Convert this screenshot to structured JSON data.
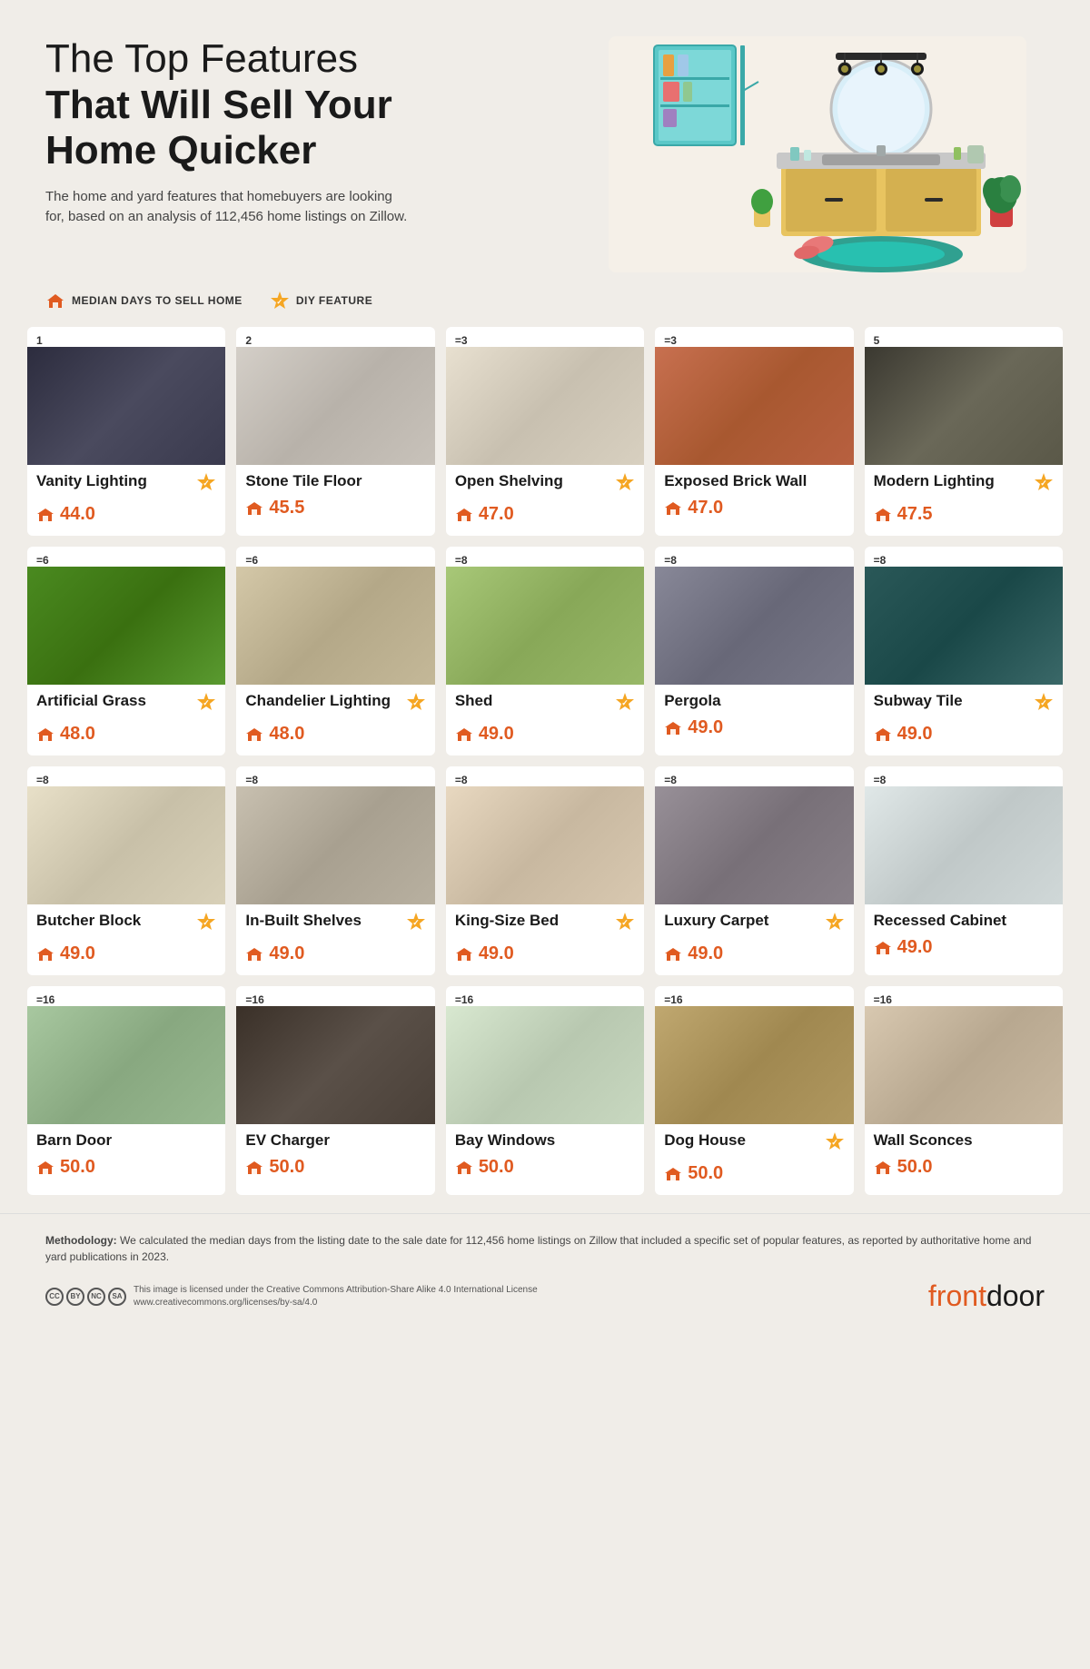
{
  "page": {
    "title_line1": "The Top Features",
    "title_line2": "That Will Sell Your",
    "title_line3": "Home Quicker",
    "subtitle": "The home and yard features that homebuyers are looking for, based on an analysis of 112,456 home listings on Zillow."
  },
  "legend": {
    "item1_label": "MEDIAN DAYS TO SELL HOME",
    "item2_label": "DIY FEATURE"
  },
  "rows": [
    {
      "cards": [
        {
          "rank": "1",
          "name": "Vanity Lighting",
          "days": "44.0",
          "diy": true,
          "img_class": "img-vanity"
        },
        {
          "rank": "2",
          "name": "Stone Tile Floor",
          "days": "45.5",
          "diy": false,
          "img_class": "img-stone"
        },
        {
          "rank": "=3",
          "name": "Open Shelving",
          "days": "47.0",
          "diy": true,
          "img_class": "img-shelving"
        },
        {
          "rank": "=3",
          "name": "Exposed Brick Wall",
          "days": "47.0",
          "diy": false,
          "img_class": "img-brick"
        },
        {
          "rank": "5",
          "name": "Modern Lighting",
          "days": "47.5",
          "diy": true,
          "img_class": "img-modern"
        }
      ]
    },
    {
      "cards": [
        {
          "rank": "=6",
          "name": "Artificial Grass",
          "days": "48.0",
          "diy": true,
          "img_class": "img-grass"
        },
        {
          "rank": "=6",
          "name": "Chandelier Lighting",
          "days": "48.0",
          "diy": true,
          "img_class": "img-chandelier"
        },
        {
          "rank": "=8",
          "name": "Shed",
          "days": "49.0",
          "diy": true,
          "img_class": "img-shed"
        },
        {
          "rank": "=8",
          "name": "Pergola",
          "days": "49.0",
          "diy": false,
          "img_class": "img-pergola"
        },
        {
          "rank": "=8",
          "name": "Subway Tile",
          "days": "49.0",
          "diy": true,
          "img_class": "img-subway"
        }
      ]
    },
    {
      "cards": [
        {
          "rank": "=8",
          "name": "Butcher Block",
          "days": "49.0",
          "diy": true,
          "img_class": "img-butcher"
        },
        {
          "rank": "=8",
          "name": "In-Built Shelves",
          "days": "49.0",
          "diy": true,
          "img_class": "img-shelves"
        },
        {
          "rank": "=8",
          "name": "King-Size Bed",
          "days": "49.0",
          "diy": true,
          "img_class": "img-kingbed"
        },
        {
          "rank": "=8",
          "name": "Luxury Carpet",
          "days": "49.0",
          "diy": true,
          "img_class": "img-carpet"
        },
        {
          "rank": "=8",
          "name": "Recessed Cabinet",
          "days": "49.0",
          "diy": false,
          "img_class": "img-recessed"
        }
      ]
    },
    {
      "cards": [
        {
          "rank": "=16",
          "name": "Barn Door",
          "days": "50.0",
          "diy": false,
          "img_class": "img-barn"
        },
        {
          "rank": "=16",
          "name": "EV Charger",
          "days": "50.0",
          "diy": false,
          "img_class": "img-ev"
        },
        {
          "rank": "=16",
          "name": "Bay Windows",
          "days": "50.0",
          "diy": false,
          "img_class": "img-bay"
        },
        {
          "rank": "=16",
          "name": "Dog House",
          "days": "50.0",
          "diy": true,
          "img_class": "img-doghouse"
        },
        {
          "rank": "=16",
          "name": "Wall Sconces",
          "days": "50.0",
          "diy": false,
          "img_class": "img-sconces"
        }
      ]
    }
  ],
  "footer": {
    "methodology_label": "Methodology:",
    "methodology_text": "We calculated the median days from the listing date to the sale date for 112,456 home listings on Zillow that included a specific set of popular features, as reported by authoritative home and yard publications in 2023.",
    "cc_line1": "This image is licensed under the Creative Commons Attribution-Share Alike 4.0 International License",
    "cc_line2": "www.creativecommons.org/licenses/by-sa/4.0",
    "brand": "front",
    "brand2": "door"
  },
  "colors": {
    "accent_orange": "#e05a20",
    "diy_yellow": "#f5a623",
    "bg": "#f0ede8",
    "card_bg": "#ffffff"
  }
}
